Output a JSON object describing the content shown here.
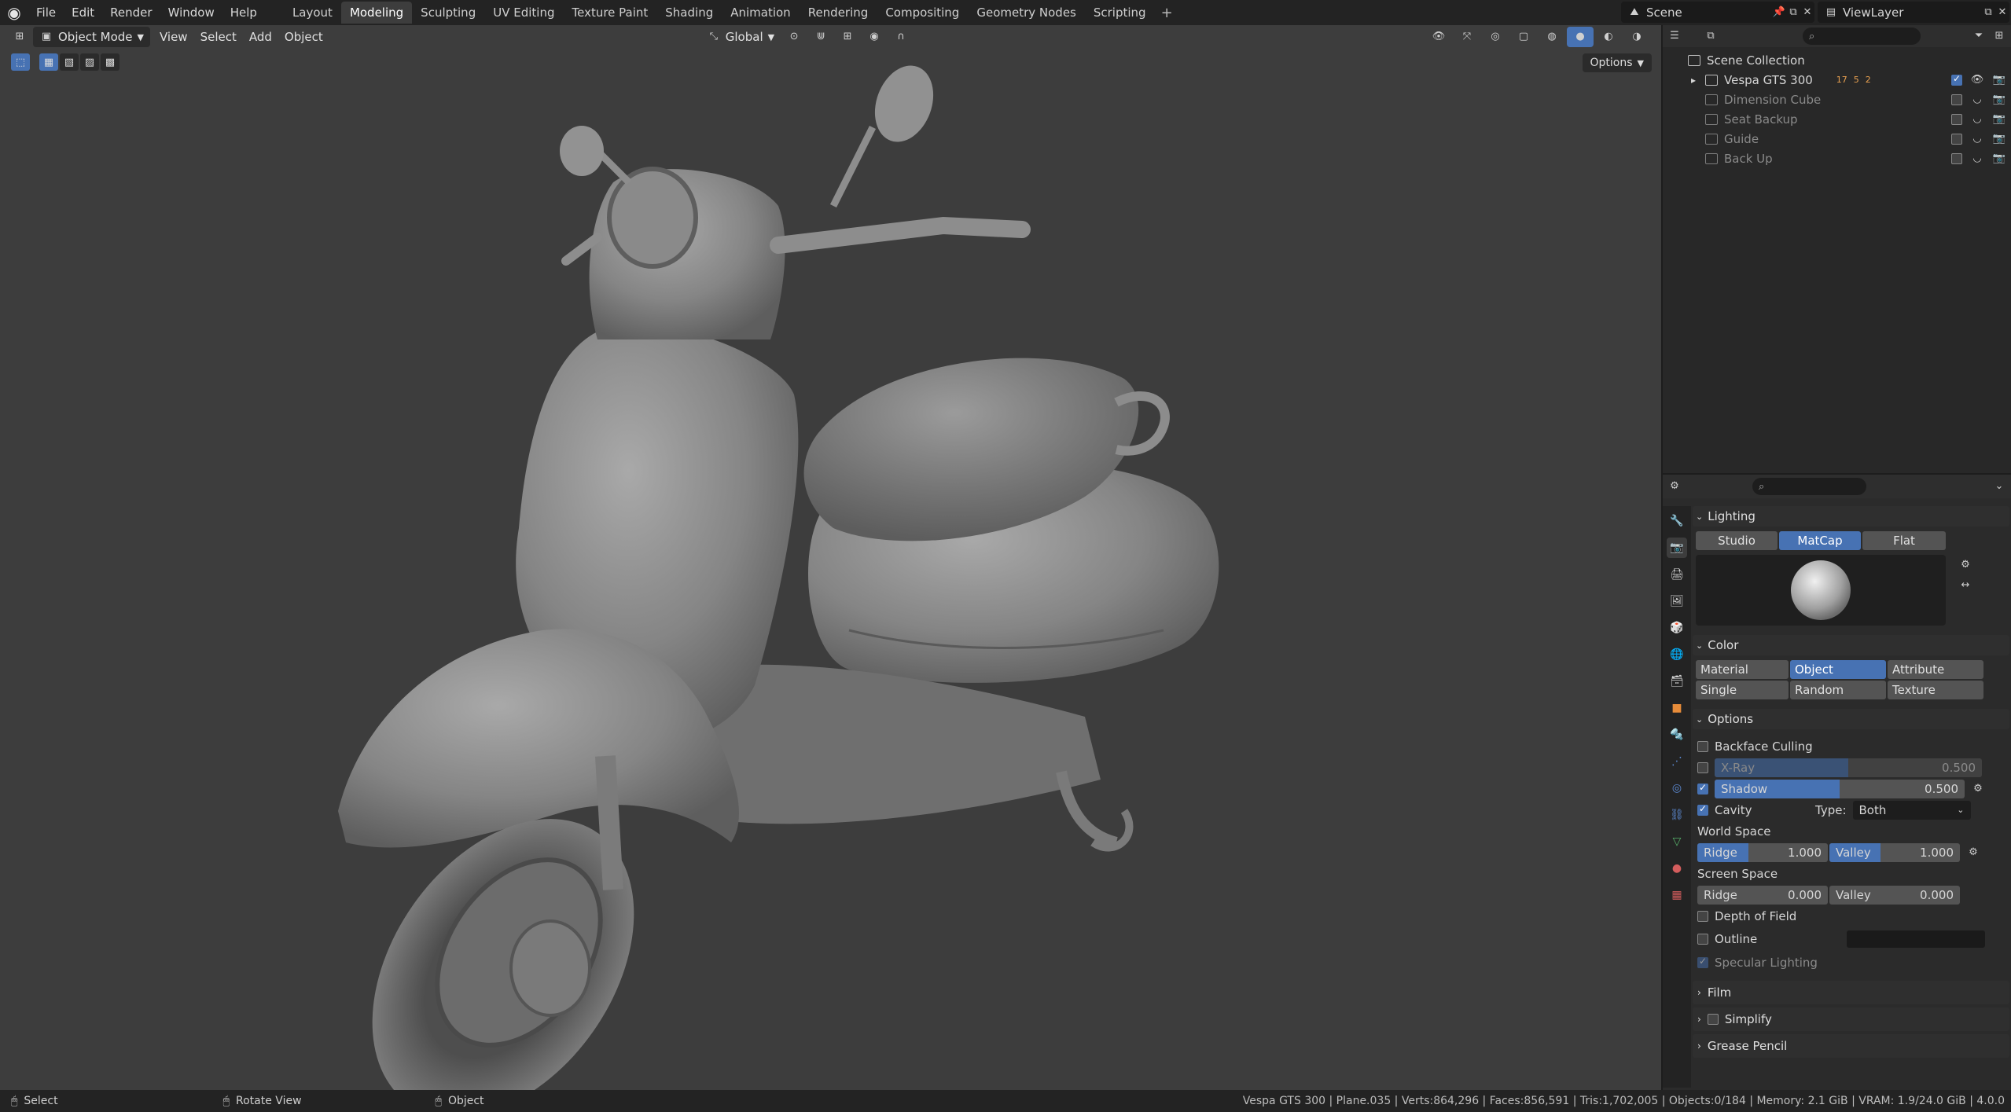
{
  "topbar": {
    "menus": [
      "File",
      "Edit",
      "Render",
      "Window",
      "Help"
    ],
    "workspaces": [
      "Layout",
      "Modeling",
      "Sculpting",
      "UV Editing",
      "Texture Paint",
      "Shading",
      "Animation",
      "Rendering",
      "Compositing",
      "Geometry Nodes",
      "Scripting"
    ],
    "active_workspace": "Modeling",
    "add_symbol": "+",
    "scene": "Scene",
    "view_layer": "ViewLayer"
  },
  "viewport": {
    "mode": "Object Mode",
    "menus": [
      "View",
      "Select",
      "Add",
      "Object"
    ],
    "orientation": "Global",
    "options": "Options"
  },
  "outliner": {
    "root": "Scene Collection",
    "items": [
      {
        "label": "Vespa GTS 300",
        "enabled": true,
        "badges": [
          "17",
          "5",
          "2"
        ]
      },
      {
        "label": "Dimension Cube",
        "enabled": false
      },
      {
        "label": "Seat Backup",
        "enabled": false
      },
      {
        "label": "Guide",
        "enabled": false
      },
      {
        "label": "Back Up",
        "enabled": false
      }
    ]
  },
  "properties": {
    "lighting": {
      "title": "Lighting",
      "options": [
        "Studio",
        "MatCap",
        "Flat"
      ],
      "active": "MatCap"
    },
    "color": {
      "title": "Color",
      "options_row1": [
        "Material",
        "Object",
        "Attribute"
      ],
      "options_row2": [
        "Single",
        "Random",
        "Texture"
      ],
      "active": "Object"
    },
    "options": {
      "title": "Options",
      "backface_culling": "Backface Culling",
      "xray": {
        "label": "X-Ray",
        "value": "0.500",
        "fraction": 0.5,
        "enabled": false
      },
      "shadow": {
        "label": "Shadow",
        "value": "0.500",
        "fraction": 0.5,
        "enabled": true
      },
      "cavity": {
        "label": "Cavity",
        "enabled": true
      },
      "type_label": "Type:",
      "type_value": "Both",
      "world_space": "World Space",
      "world_ridge": {
        "label": "Ridge",
        "value": "1.000"
      },
      "world_valley": {
        "label": "Valley",
        "value": "1.000"
      },
      "screen_space": "Screen Space",
      "screen_ridge": {
        "label": "Ridge",
        "value": "0.000"
      },
      "screen_valley": {
        "label": "Valley",
        "value": "0.000"
      },
      "depth_of_field": "Depth of Field",
      "outline": "Outline",
      "specular": "Specular Lighting"
    },
    "film": "Film",
    "simplify": "Simplify",
    "grease_pencil": "Grease Pencil"
  },
  "statusbar": {
    "select": "Select",
    "rotate": "Rotate View",
    "object": "Object",
    "stats": "Vespa GTS 300 | Plane.035 | Verts:864,296 | Faces:856,591 | Tris:1,702,005 | Objects:0/184 | Memory: 2.1 GiB | VRAM: 1.9/24.0 GiB | 4.0.0"
  },
  "colors": {
    "accent": "#4772b3",
    "viewport_bg": "#3d3d3d",
    "panel_bg": "#2b2b2b"
  }
}
